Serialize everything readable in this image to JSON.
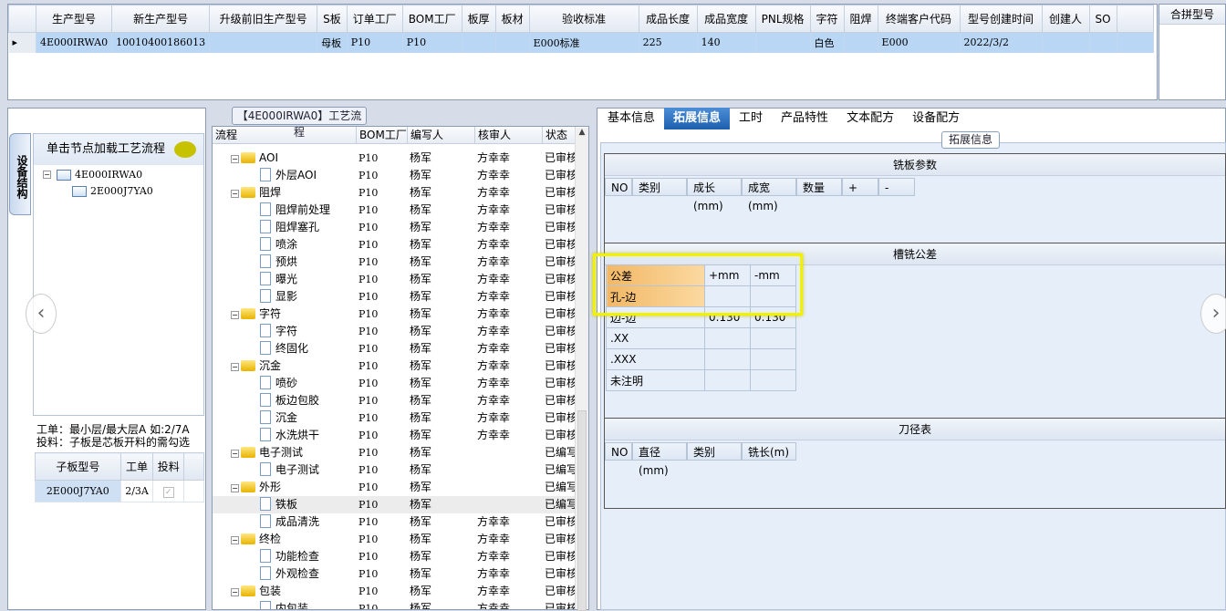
{
  "grid": {
    "headers": [
      "生产型号",
      "新生产型号",
      "升级前旧生产型号",
      "S板",
      "订单工厂",
      "BOM工厂",
      "板厚",
      "板材",
      "验收标准",
      "成品长度",
      "成品宽度",
      "PNL规格",
      "字符",
      "阻焊",
      "终端客户代码",
      "型号创建时间",
      "创建人",
      "SO"
    ],
    "row": [
      "4E000IRWA0",
      "10010400186013",
      "",
      "母板",
      "P10",
      "P10",
      "",
      "",
      "E000标准",
      "225",
      "140",
      "",
      "白色",
      "",
      "E000",
      "2022/3/2",
      "",
      ""
    ]
  },
  "merge_header": "合拼型号",
  "left": {
    "vtab": "设备结构",
    "header": "单击节点加载工艺流程",
    "tree": [
      "4E000IRWA0",
      "2E000J7YA0"
    ],
    "note1": "工单：最小层/最大层A 如:2/7A",
    "note2": "投料：子板是芯板开料的需勾选",
    "sub_headers": [
      "子板型号",
      "工单",
      "投料"
    ],
    "sub_row": [
      "2E000J7YA0",
      "2/3A"
    ]
  },
  "mid": {
    "title": "【4E000IRWA0】工艺流程",
    "headers": [
      "流程",
      "BOM工厂",
      "编写人",
      "核审人",
      "状态"
    ],
    "rows": [
      [
        "f",
        "AOI",
        "P10",
        "杨军",
        "方幸幸",
        "已审核"
      ],
      [
        "d",
        "外层AOI",
        "P10",
        "杨军",
        "方幸幸",
        "已审核"
      ],
      [
        "f",
        "阻焊",
        "P10",
        "杨军",
        "方幸幸",
        "已审核"
      ],
      [
        "d",
        "阻焊前处理",
        "P10",
        "杨军",
        "方幸幸",
        "已审核"
      ],
      [
        "d",
        "阻焊塞孔",
        "P10",
        "杨军",
        "方幸幸",
        "已审核"
      ],
      [
        "d",
        "喷涂",
        "P10",
        "杨军",
        "方幸幸",
        "已审核"
      ],
      [
        "d",
        "预烘",
        "P10",
        "杨军",
        "方幸幸",
        "已审核"
      ],
      [
        "d",
        "曝光",
        "P10",
        "杨军",
        "方幸幸",
        "已审核"
      ],
      [
        "d",
        "显影",
        "P10",
        "杨军",
        "方幸幸",
        "已审核"
      ],
      [
        "f",
        "字符",
        "P10",
        "杨军",
        "方幸幸",
        "已审核"
      ],
      [
        "d",
        "字符",
        "P10",
        "杨军",
        "方幸幸",
        "已审核"
      ],
      [
        "d",
        "终固化",
        "P10",
        "杨军",
        "方幸幸",
        "已审核"
      ],
      [
        "f",
        "沉金",
        "P10",
        "杨军",
        "方幸幸",
        "已审核"
      ],
      [
        "d",
        "喷砂",
        "P10",
        "杨军",
        "方幸幸",
        "已审核"
      ],
      [
        "d",
        "板边包胶",
        "P10",
        "杨军",
        "方幸幸",
        "已审核"
      ],
      [
        "d",
        "沉金",
        "P10",
        "杨军",
        "方幸幸",
        "已审核"
      ],
      [
        "d",
        "水洗烘干",
        "P10",
        "杨军",
        "方幸幸",
        "已审核"
      ],
      [
        "f",
        "电子测试",
        "P10",
        "杨军",
        "",
        "已编写"
      ],
      [
        "d",
        "电子测试",
        "P10",
        "杨军",
        "",
        "已编写"
      ],
      [
        "f",
        "外形",
        "P10",
        "杨军",
        "",
        "已编写"
      ],
      [
        "s",
        "铁板",
        "P10",
        "杨军",
        "",
        "已编写"
      ],
      [
        "d",
        "成品清洗",
        "P10",
        "杨军",
        "方幸幸",
        "已审核"
      ],
      [
        "f",
        "终检",
        "P10",
        "杨军",
        "方幸幸",
        "已审核"
      ],
      [
        "d",
        "功能检查",
        "P10",
        "杨军",
        "方幸幸",
        "已审核"
      ],
      [
        "d",
        "外观检查",
        "P10",
        "杨军",
        "方幸幸",
        "已审核"
      ],
      [
        "f",
        "包装",
        "P10",
        "杨军",
        "方幸幸",
        "已审核"
      ],
      [
        "d",
        "内包装",
        "P10",
        "杨军",
        "方幸幸",
        "已审核"
      ]
    ]
  },
  "right": {
    "tabs": [
      "基本信息",
      "拓展信息",
      "工时",
      "产品特性",
      "文本配方",
      "设备配方"
    ],
    "group": "拓展信息",
    "s1": {
      "title": "铣板参数",
      "headers": [
        "NO",
        "类别",
        "成长(mm)",
        "成宽(mm)",
        "数量",
        "+",
        "-"
      ]
    },
    "s2": {
      "title": "槽铣公差",
      "headers": [
        "公差",
        "+mm",
        "-mm"
      ],
      "rows": [
        [
          "孔-边",
          "",
          ""
        ],
        [
          "边-边",
          "0.130",
          "0.130"
        ],
        [
          ".XX",
          "",
          ""
        ],
        [
          ".XXX",
          "",
          ""
        ],
        [
          "未注明",
          "",
          ""
        ]
      ]
    },
    "s3": {
      "title": "刀径表",
      "headers": [
        "NO",
        "直径(mm)",
        "类别",
        "铣长(m)"
      ]
    }
  }
}
